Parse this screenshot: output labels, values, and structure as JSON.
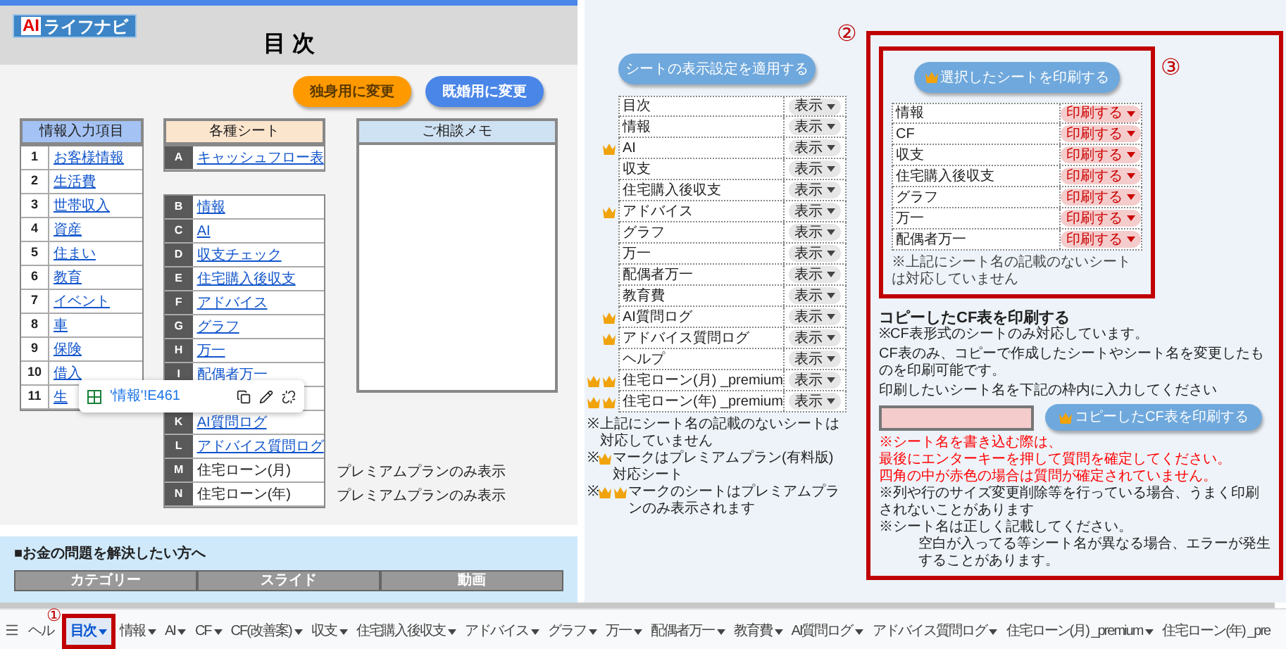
{
  "header": {
    "logo": {
      "accent": "AI",
      "text": "ライフナビ"
    },
    "title": "目 次"
  },
  "mode_buttons": [
    {
      "label": "独身用に変更",
      "color": "#ff9900"
    },
    {
      "label": "既婚用に変更",
      "color": "#4a86e8"
    }
  ],
  "input_items": {
    "title": "情報入力項目",
    "rows": [
      {
        "no": "1",
        "name": "お客様情報"
      },
      {
        "no": "2",
        "name": "生活費"
      },
      {
        "no": "3",
        "name": "世帯収入"
      },
      {
        "no": "4",
        "name": "資産"
      },
      {
        "no": "5",
        "name": "住まい"
      },
      {
        "no": "6",
        "name": "教育"
      },
      {
        "no": "7",
        "name": "イベント"
      },
      {
        "no": "8",
        "name": "車"
      },
      {
        "no": "9",
        "name": "保険"
      },
      {
        "no": "10",
        "name": "借入"
      },
      {
        "no": "11",
        "name": "生"
      }
    ]
  },
  "sheets": {
    "title": "各種シート",
    "groups": [
      [
        {
          "kind": "link",
          "letter": "A",
          "name": "キャッシュフロー表"
        }
      ],
      [
        {
          "kind": "link",
          "letter": "B",
          "name": "情報"
        },
        {
          "kind": "link",
          "letter": "C",
          "name": "AI"
        },
        {
          "kind": "link",
          "letter": "D",
          "name": "収支チェック"
        },
        {
          "kind": "link",
          "letter": "E",
          "name": "住宅購入後収支"
        },
        {
          "kind": "link",
          "letter": "F",
          "name": "アドバイス"
        },
        {
          "kind": "link",
          "letter": "G",
          "name": "グラフ"
        },
        {
          "kind": "link",
          "letter": "H",
          "name": "万一"
        },
        {
          "kind": "link",
          "letter": "I",
          "name": "配偶者万一"
        },
        {
          "kind": "covered"
        },
        {
          "kind": "link",
          "letter": "K",
          "name": "AI質問ログ"
        },
        {
          "kind": "link",
          "letter": "L",
          "name": "アドバイス質問ログ"
        },
        {
          "kind": "plain",
          "letter": "M",
          "name": "住宅ローン(月)",
          "note": "プレミアムプランのみ表示"
        },
        {
          "kind": "plain",
          "letter": "N",
          "name": "住宅ローン(年)",
          "note": "プレミアムプランのみ表示"
        }
      ]
    ]
  },
  "memo": {
    "title": "ご相談メモ"
  },
  "link_popup": {
    "text": "'情報'!E461"
  },
  "help_card": {
    "title": "■お金の問題を解決したい方へ",
    "columns": [
      "カテゴリー",
      "スライド",
      "動画"
    ]
  },
  "display_settings": {
    "button": "シートの表示設定を適用する",
    "rows": [
      {
        "kind": "standard",
        "name": "目次",
        "value": "表示"
      },
      {
        "kind": "standard",
        "name": "情報",
        "value": "表示"
      },
      {
        "kind": "premium",
        "name": "AI",
        "value": "表示"
      },
      {
        "kind": "standard",
        "name": "収支",
        "value": "表示"
      },
      {
        "kind": "standard",
        "name": "住宅購入後収支",
        "value": "表示"
      },
      {
        "kind": "premium",
        "name": "アドバイス",
        "value": "表示"
      },
      {
        "kind": "standard",
        "name": "グラフ",
        "value": "表示"
      },
      {
        "kind": "standard",
        "name": "万一",
        "value": "表示"
      },
      {
        "kind": "standard",
        "name": "配偶者万一",
        "value": "表示"
      },
      {
        "kind": "standard",
        "name": "教育費",
        "value": "表示"
      },
      {
        "kind": "premium",
        "name": "AI質問ログ",
        "value": "表示"
      },
      {
        "kind": "premium",
        "name": "アドバイス質問ログ",
        "value": "表示"
      },
      {
        "kind": "standard",
        "name": "ヘルプ",
        "value": "表示"
      },
      {
        "kind": "premium_only",
        "name": "住宅ローン(月) _premium",
        "value": "表示"
      },
      {
        "kind": "premium_only",
        "name": "住宅ローン(年) _premium",
        "value": "表示"
      }
    ],
    "notes": [
      {
        "kind": "standard",
        "prefix": "※",
        "text": "上記にシート名の記載のないシートは対応していません"
      },
      {
        "kind": "premium",
        "prefix": "※",
        "text": "マークはプレミアムプラン(有料版)対応シート"
      },
      {
        "kind": "premium_only",
        "prefix": "※",
        "text": "マークのシートはプレミアムプランのみ表示されます"
      }
    ]
  },
  "print_section": {
    "annotation": "②",
    "selected_print": {
      "annotation": "③",
      "button": {
        "label": "選択したシートを印刷する",
        "crown": true
      },
      "rows": [
        {
          "name": "情報",
          "value": "印刷する"
        },
        {
          "name": "CF",
          "value": "印刷する"
        },
        {
          "name": "収支",
          "value": "印刷する"
        },
        {
          "name": "住宅購入後収支",
          "value": "印刷する"
        },
        {
          "name": "グラフ",
          "value": "印刷する"
        },
        {
          "name": "万一",
          "value": "印刷する"
        },
        {
          "name": "配偶者万一",
          "value": "印刷する"
        }
      ],
      "note": "※上記にシート名の記載のないシートは対応していません"
    },
    "copy_print": {
      "title": "コピーしたCF表を印刷する",
      "title_note": "※CF表形式のシートのみ対応しています。",
      "description": "CF表のみ、コピーで作成したシートやシート名を変更したものを印刷可能です。",
      "instruction": "印刷したいシート名を下記の枠内に入力してください",
      "button": {
        "label": "コピーしたCF表を印刷する",
        "crown": true
      },
      "lines": [
        {
          "kind": "warning",
          "text": "※シート名を書き込む際は、"
        },
        {
          "kind": "warning",
          "text": "最後にエンターキーを押して質問を確定してください。"
        },
        {
          "kind": "warning",
          "text": "四角の中が赤色の場合は質問が確定されていません。"
        },
        {
          "kind": "note",
          "text": "※列や行のサイズ変更削除等を行っている場合、うまく印刷されないことがあります"
        },
        {
          "kind": "note",
          "text": "※シート名は正しく記載してください。"
        },
        {
          "kind": "continuation",
          "text": "空白が入ってる等シート名が異なる場合、エラーが発生することがあります。"
        }
      ]
    }
  },
  "sheet_tabs": [
    {
      "label": "ヘル",
      "selected": false,
      "caret": false
    },
    {
      "label": "目次",
      "selected": true,
      "caret": true,
      "annotation": "①"
    },
    {
      "label": "情報",
      "selected": false,
      "caret": true
    },
    {
      "label": "AI",
      "selected": false,
      "caret": true
    },
    {
      "label": "CF",
      "selected": false,
      "caret": true
    },
    {
      "label": "CF(改善案)",
      "selected": false,
      "caret": true
    },
    {
      "label": "収支",
      "selected": false,
      "caret": true
    },
    {
      "label": "住宅購入後収支",
      "selected": false,
      "caret": true
    },
    {
      "label": "アドバイス",
      "selected": false,
      "caret": true
    },
    {
      "label": "グラフ",
      "selected": false,
      "caret": true
    },
    {
      "label": "万一",
      "selected": false,
      "caret": true
    },
    {
      "label": "配偶者万一",
      "selected": false,
      "caret": true
    },
    {
      "label": "教育費",
      "selected": false,
      "caret": true
    },
    {
      "label": "AI質問ログ",
      "selected": false,
      "caret": true
    },
    {
      "label": "アドバイス質問ログ",
      "selected": false,
      "caret": true
    },
    {
      "label": "住宅ローン(月) _premium",
      "selected": false,
      "caret": true
    },
    {
      "label": "住宅ローン(年) _pre",
      "selected": false,
      "caret": false
    }
  ]
}
